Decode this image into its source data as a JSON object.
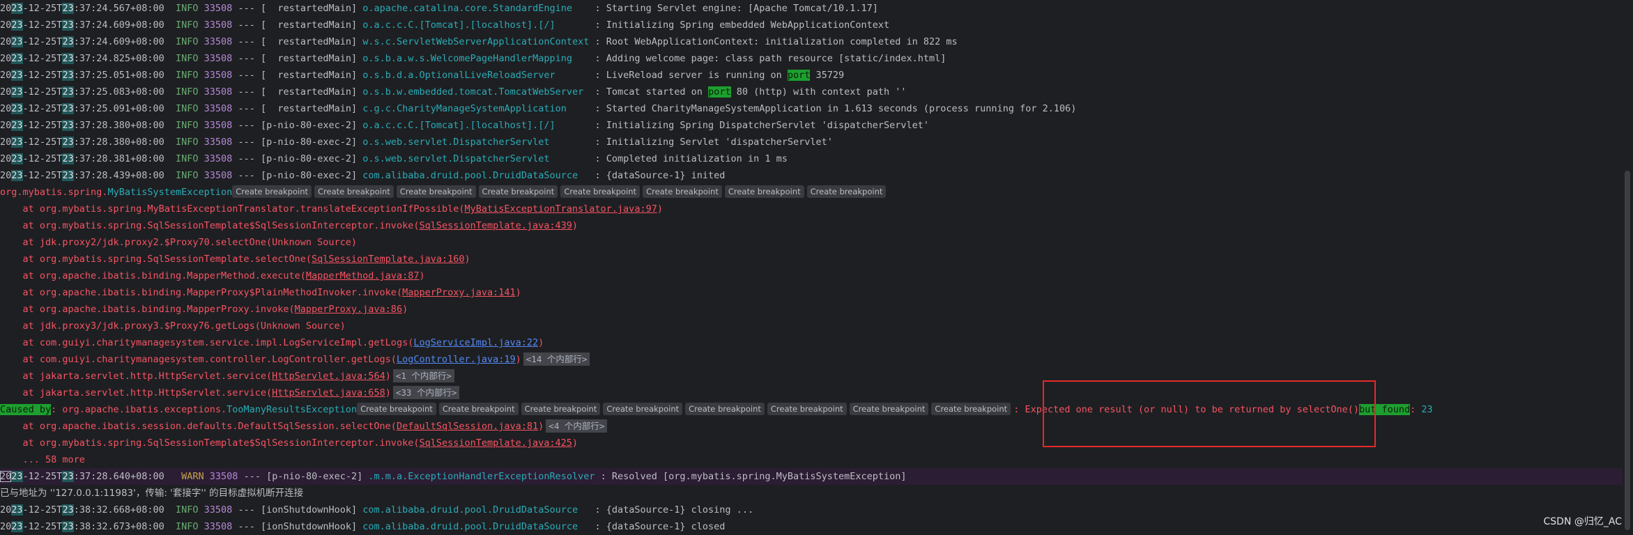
{
  "top_log": [
    {
      "d1": "20",
      "d2": "23",
      "d3": "-12-25T",
      "d4": "23",
      "rest": ":37:24.567+08:00",
      "level": "INFO",
      "pid": "33508",
      "thread": "[  restartedMain]",
      "logger": "o.apache.catalina.core.StandardEngine   ",
      "msg": "Starting Servlet engine: [Apache Tomcat/10.1.17]"
    },
    {
      "d1": "20",
      "d2": "23",
      "d3": "-12-25T",
      "d4": "23",
      "rest": ":37:24.609+08:00",
      "level": "INFO",
      "pid": "33508",
      "thread": "[  restartedMain]",
      "logger": "o.a.c.c.C.[Tomcat].[localhost].[/]      ",
      "msg": "Initializing Spring embedded WebApplicationContext"
    },
    {
      "d1": "20",
      "d2": "23",
      "d3": "-12-25T",
      "d4": "23",
      "rest": ":37:24.609+08:00",
      "level": "INFO",
      "pid": "33508",
      "thread": "[  restartedMain]",
      "logger": "w.s.c.ServletWebServerApplicationContext",
      "msg": "Root WebApplicationContext: initialization completed in 822 ms"
    },
    {
      "d1": "20",
      "d2": "23",
      "d3": "-12-25T",
      "d4": "23",
      "rest": ":37:24.825+08:00",
      "level": "INFO",
      "pid": "33508",
      "thread": "[  restartedMain]",
      "logger": "o.s.b.a.w.s.WelcomePageHandlerMapping   ",
      "msg": "Adding welcome page: class path resource [static/index.html]"
    },
    {
      "d1": "20",
      "d2": "23",
      "d3": "-12-25T",
      "d4": "23",
      "rest": ":37:25.051+08:00",
      "level": "INFO",
      "pid": "33508",
      "thread": "[  restartedMain]",
      "logger": "o.s.b.d.a.OptionalLiveReloadServer      ",
      "msg_pre": "LiveReload server is running on ",
      "msg_hl": "port",
      "msg_post": " 35729"
    },
    {
      "d1": "20",
      "d2": "23",
      "d3": "-12-25T",
      "d4": "23",
      "rest": ":37:25.083+08:00",
      "level": "INFO",
      "pid": "33508",
      "thread": "[  restartedMain]",
      "logger": "o.s.b.w.embedded.tomcat.TomcatWebServer ",
      "msg_pre": "Tomcat started on ",
      "msg_hl": "port",
      "msg_post": " 80 (http) with context path ''"
    },
    {
      "d1": "20",
      "d2": "23",
      "d3": "-12-25T",
      "d4": "23",
      "rest": ":37:25.091+08:00",
      "level": "INFO",
      "pid": "33508",
      "thread": "[  restartedMain]",
      "logger": "c.g.c.CharityManageSystemApplication    ",
      "msg": "Started CharityManageSystemApplication in 1.613 seconds (process running for 2.106)"
    },
    {
      "d1": "20",
      "d2": "23",
      "d3": "-12-25T",
      "d4": "23",
      "rest": ":37:28.380+08:00",
      "level": "INFO",
      "pid": "33508",
      "thread": "[p-nio-80-exec-2]",
      "logger": "o.a.c.c.C.[Tomcat].[localhost].[/]      ",
      "msg": "Initializing Spring DispatcherServlet 'dispatcherServlet'"
    },
    {
      "d1": "20",
      "d2": "23",
      "d3": "-12-25T",
      "d4": "23",
      "rest": ":37:28.380+08:00",
      "level": "INFO",
      "pid": "33508",
      "thread": "[p-nio-80-exec-2]",
      "logger": "o.s.web.servlet.DispatcherServlet       ",
      "msg": "Initializing Servlet 'dispatcherServlet'"
    },
    {
      "d1": "20",
      "d2": "23",
      "d3": "-12-25T",
      "d4": "23",
      "rest": ":37:28.381+08:00",
      "level": "INFO",
      "pid": "33508",
      "thread": "[p-nio-80-exec-2]",
      "logger": "o.s.web.servlet.DispatcherServlet       ",
      "msg": "Completed initialization in 1 ms"
    },
    {
      "d1": "20",
      "d2": "23",
      "d3": "-12-25T",
      "d4": "23",
      "rest": ":37:28.439+08:00",
      "level": "INFO",
      "pid": "33508",
      "thread": "[p-nio-80-exec-2]",
      "logger": "com.alibaba.druid.pool.DruidDataSource  ",
      "msg": "{dataSource-1} inited"
    }
  ],
  "exception": {
    "pkg": "org.mybatis.spring.",
    "cls": "MyBatisSystemException",
    "breakpoint_label": "Create breakpoint"
  },
  "stack": [
    {
      "text": "    at org.mybatis.spring.MyBatisExceptionTranslator.translateExceptionIfPossible(",
      "link": "MyBatisExceptionTranslator.java:97",
      "end": ")"
    },
    {
      "text": "    at org.mybatis.spring.SqlSessionTemplate$SqlSessionInterceptor.invoke(",
      "link": "SqlSessionTemplate.java:439",
      "end": ")"
    },
    {
      "text": "    at jdk.proxy2/jdk.proxy2.$Proxy70.selectOne(Unknown Source)",
      "link": "",
      "end": ""
    },
    {
      "text": "    at org.mybatis.spring.SqlSessionTemplate.selectOne(",
      "link": "SqlSessionTemplate.java:160",
      "end": ")"
    },
    {
      "text": "    at org.apache.ibatis.binding.MapperMethod.execute(",
      "link": "MapperMethod.java:87",
      "end": ")"
    },
    {
      "text": "    at org.apache.ibatis.binding.MapperProxy$PlainMethodInvoker.invoke(",
      "link": "MapperProxy.java:141",
      "end": ")"
    },
    {
      "text": "    at org.apache.ibatis.binding.MapperProxy.invoke(",
      "link": "MapperProxy.java:86",
      "end": ")"
    },
    {
      "text": "    at jdk.proxy3/jdk.proxy3.$Proxy76.getLogs(Unknown Source)",
      "link": "",
      "end": ""
    },
    {
      "text": "    at com.guiyi.charitymanagesystem.service.impl.LogServiceImpl.getLogs(",
      "link": "LogServiceImpl.java:22",
      "end": ")",
      "blue": true
    },
    {
      "text": "    at com.guiyi.charitymanagesystem.controller.LogController.getLogs(",
      "link": "LogController.java:19",
      "end": ")",
      "blue": true,
      "fold": "<14 个内部行>"
    },
    {
      "text": "    at jakarta.servlet.http.HttpServlet.service(",
      "link": "HttpServlet.java:564",
      "end": ")",
      "fold": "<1 个内部行>"
    },
    {
      "text": "    at jakarta.servlet.http.HttpServlet.service(",
      "link": "HttpServlet.java:658",
      "end": ")",
      "fold": "<33 个内部行>"
    }
  ],
  "caused_by": {
    "label": "Caused by",
    "pkg": ": org.apache.ibatis.exceptions.",
    "cls": "TooManyResultsException",
    "msg_pre": ": Expected one result (or null) to be returned by selectOne()",
    "msg_hl": "but found",
    "msg_post": ": ",
    "count": "23"
  },
  "stack2": [
    {
      "text": "    at org.apache.ibatis.session.defaults.DefaultSqlSession.selectOne(",
      "link": "DefaultSqlSession.java:81",
      "end": ")",
      "fold": "<4 个内部行>"
    },
    {
      "text": "    at org.mybatis.spring.SqlSessionTemplate$SqlSessionInterceptor.invoke(",
      "link": "SqlSessionTemplate.java:425",
      "end": ")"
    },
    {
      "text": "    ... 58 more",
      "link": "",
      "end": ""
    }
  ],
  "warn_line": {
    "d1": "20",
    "d2": "23",
    "d3": "-12-25T",
    "d4": "23",
    "rest": ":37:28.640+08:00",
    "level": " WARN",
    "pid": "33508",
    "thread": "[p-nio-80-exec-2]",
    "logger": ".m.m.a.ExceptionHandlerExceptionResolver",
    "msg": "Resolved [org.mybatis.spring.MyBatisSystemException]"
  },
  "disconnect": "已与地址为 ''127.0.0.1:11983'，传输: '套接字'' 的目标虚拟机断开连接",
  "bottom_log": [
    {
      "d1": "20",
      "d2": "23",
      "d3": "-12-25T",
      "d4": "23",
      "rest": ":38:32.668+08:00",
      "level": "INFO",
      "pid": "33508",
      "thread": "[ionShutdownHook]",
      "logger": "com.alibaba.druid.pool.DruidDataSource  ",
      "msg": "{dataSource-1} closing ..."
    },
    {
      "d1": "20",
      "d2": "23",
      "d3": "-12-25T",
      "d4": "23",
      "rest": ":38:32.673+08:00",
      "level": "INFO",
      "pid": "33508",
      "thread": "[ionShutdownHook]",
      "logger": "com.alibaba.druid.pool.DruidDataSource  ",
      "msg": "{dataSource-1} closed"
    }
  ],
  "watermark": "CSDN @归忆_AC",
  "colors": {
    "info": "#6aab73",
    "warn": "#c7a34e",
    "error": "#f75464",
    "highlight": "#1d9f2f",
    "box": "#e5292a"
  }
}
